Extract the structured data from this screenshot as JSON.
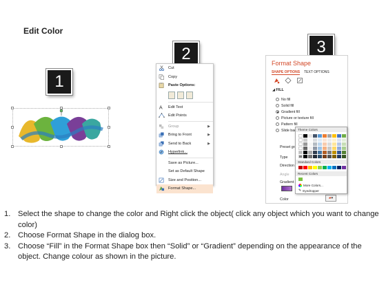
{
  "title": "Edit Color",
  "steps": [
    "1",
    "2",
    "3"
  ],
  "context_menu": {
    "items": [
      {
        "label": "Cut",
        "icon": "scissors-icon",
        "disabled": false
      },
      {
        "label": "Copy",
        "icon": "copy-icon",
        "disabled": false
      },
      {
        "label": "Paste Options:",
        "icon": "paste-icon",
        "disabled": false,
        "bold": true
      },
      {
        "label": "Edit Text",
        "icon": "edit-text-icon",
        "disabled": false
      },
      {
        "label": "Edit Points",
        "icon": "edit-points-icon",
        "disabled": false
      },
      {
        "label": "Group",
        "icon": "group-icon",
        "disabled": true,
        "submenu": true
      },
      {
        "label": "Bring to Front",
        "icon": "bring-front-icon",
        "disabled": false,
        "submenu": true
      },
      {
        "label": "Send to Back",
        "icon": "send-back-icon",
        "disabled": false,
        "submenu": true
      },
      {
        "label": "Hyperlink...",
        "icon": "hyperlink-icon",
        "disabled": false
      },
      {
        "label": "Save as Picture...",
        "icon": "",
        "disabled": false
      },
      {
        "label": "Set as Default Shape",
        "icon": "",
        "disabled": false
      },
      {
        "label": "Size and Position...",
        "icon": "size-position-icon",
        "disabled": false
      },
      {
        "label": "Format Shape...",
        "icon": "format-shape-icon",
        "disabled": false,
        "highlight": true
      }
    ]
  },
  "format_pane": {
    "title": "Format Shape",
    "tabs": [
      "SHAPE OPTIONS",
      "TEXT OPTIONS"
    ],
    "section": "FILL",
    "fill_options": [
      {
        "label": "No fill",
        "checked": false
      },
      {
        "label": "Solid fill",
        "checked": false
      },
      {
        "label": "Gradient fill",
        "checked": true
      },
      {
        "label": "Picture or texture fill",
        "checked": false
      },
      {
        "label": "Pattern fill",
        "checked": false
      },
      {
        "label": "Slide back",
        "checked": false
      }
    ],
    "rows": [
      "Preset grad",
      "Type",
      "Direction",
      "Angle",
      "Gradient st",
      "Color"
    ]
  },
  "color_picker": {
    "theme_label": "Theme Colors",
    "standard_label": "Standard Colors",
    "recent_label": "Recent Colors",
    "more_colors": "More Colors...",
    "eyedropper": "Eyedropper",
    "theme_top_row": [
      "#ffffff",
      "#000000",
      "#e7e6e6",
      "#44546a",
      "#5b9bd5",
      "#ed7d31",
      "#a5a5a5",
      "#ffc000",
      "#4472c4",
      "#70ad47"
    ],
    "standard_colors": [
      "#c00000",
      "#ff0000",
      "#ffc000",
      "#ffff00",
      "#92d050",
      "#00b050",
      "#00b0f0",
      "#0070c0",
      "#002060",
      "#7030a0"
    ],
    "recent_colors": [
      "#7cc242"
    ]
  },
  "instructions": [
    {
      "num": "1.",
      "text": "Select the shape to change the color and Right click the object( click any object which you want to change color)"
    },
    {
      "num": "2.",
      "text": "Choose Format Shape in the dialog box."
    },
    {
      "num": "3.",
      "text": "Choose “Fill” in the Format Shape box then “Solid” or “Gradient” depending on the appearance of the object. Change colour as shown in the picture."
    }
  ]
}
